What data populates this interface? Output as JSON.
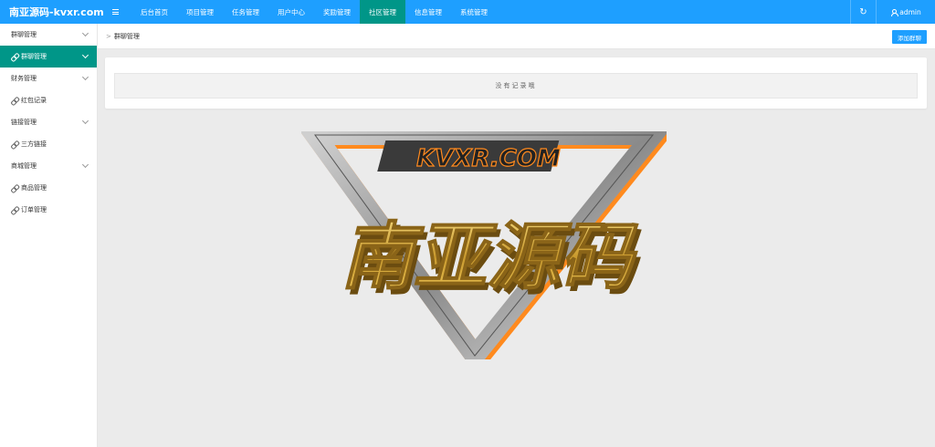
{
  "app": {
    "brand": "南亚源码-kvxr.com"
  },
  "topnav": {
    "items": [
      {
        "label": "后台首页",
        "active": false
      },
      {
        "label": "项目管理",
        "active": false
      },
      {
        "label": "任务管理",
        "active": false
      },
      {
        "label": "用户中心",
        "active": false
      },
      {
        "label": "奖励管理",
        "active": false
      },
      {
        "label": "社区管理",
        "active": true
      },
      {
        "label": "信息管理",
        "active": false
      },
      {
        "label": "系统管理",
        "active": false
      }
    ],
    "user": "admin",
    "accent": "#1e9fff",
    "active_color": "#009688"
  },
  "sidebar": {
    "items": [
      {
        "label": "群聊管理",
        "type": "group"
      },
      {
        "label": "群聊管理",
        "type": "sub",
        "active": true
      },
      {
        "label": "财务管理",
        "type": "group"
      },
      {
        "label": "红包记录",
        "type": "sub"
      },
      {
        "label": "链接管理",
        "type": "group"
      },
      {
        "label": "三方链接",
        "type": "sub"
      },
      {
        "label": "商城管理",
        "type": "group"
      },
      {
        "label": "商品管理",
        "type": "sub"
      },
      {
        "label": "订单管理",
        "type": "sub"
      }
    ]
  },
  "breadcrumb": {
    "separator": ">",
    "current": "群聊管理"
  },
  "toolbar": {
    "add_label": "添加群聊"
  },
  "table": {
    "empty_text": "没有记录哦"
  },
  "watermark": {
    "domain_text": "KVXR.COM",
    "title_text": "南亚源码"
  }
}
